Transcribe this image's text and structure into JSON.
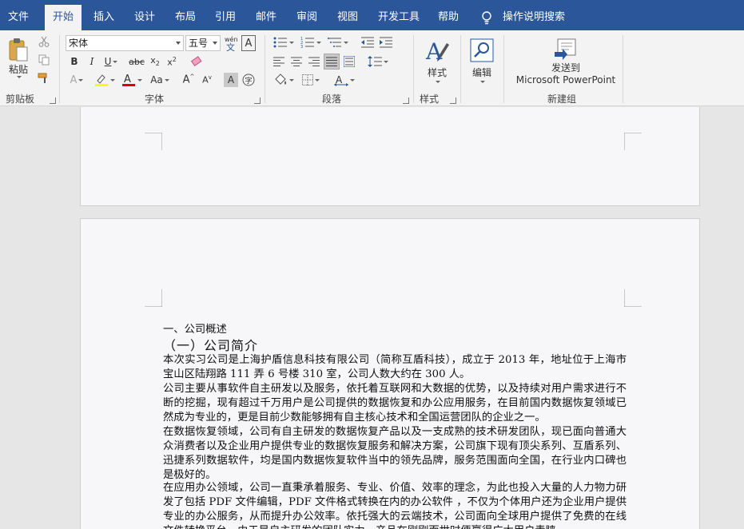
{
  "tabs": [
    {
      "label": "文件"
    },
    {
      "label": "开始"
    },
    {
      "label": "插入"
    },
    {
      "label": "设计"
    },
    {
      "label": "布局"
    },
    {
      "label": "引用"
    },
    {
      "label": "邮件"
    },
    {
      "label": "审阅"
    },
    {
      "label": "视图"
    },
    {
      "label": "开发工具"
    },
    {
      "label": "帮助"
    }
  ],
  "tell_me": "操作说明搜索",
  "ribbon": {
    "clipboard": {
      "paste_label": "粘贴",
      "group_label": "剪贴板"
    },
    "font": {
      "font_name": "宋体",
      "font_size": "五号",
      "group_label": "字体"
    },
    "paragraph": {
      "group_label": "段落"
    },
    "styles": {
      "label": "样式",
      "group_label": "样式"
    },
    "editing": {
      "label": "编辑"
    },
    "new_group": {
      "send_line1": "发送到",
      "send_line2": "Microsoft PowerPoint",
      "group_label": "新建组"
    }
  },
  "document": {
    "heading1": "一、公司概述",
    "heading2": "（一）公司简介",
    "paragraphs": [
      "本次实习公司是上海护盾信息科技有限公司（简称互盾科技），成立于 2013 年，地址位于上海市宝山区陆翔路 111 弄 6 号楼 310 室，公司人数大约在 300 人。",
      "公司主要从事软件自主研发以及服务，依托着互联网和大数据的优势，以及持续对用户需求进行不断的挖掘，现有超过千万用户是公司提供的数据恢复和办公应用服务，在目前国内数据恢复领域已然成为专业的，更是目前少数能够拥有自主核心技术和全国运营团队的企业之一。",
      "在数据恢复领域，公司有自主研发的数据恢复产品以及一支成熟的技术研发团队，现已面向普通大众消费者以及企业用户提供专业的数据恢复服务和解决方案，公司旗下现有顶尖系列、互盾系列、迅捷系列数据软件，均是国内数据恢复软件当中的领先品牌，服务范围面向全国，在行业内口碑也是极好的。",
      "在应用办公领域，公司一直秉承着服务、专业、价值、效率的理念，为此也投入大量的人力物力研发了包括 PDF 文件编辑，PDF 文件格式转换在内的办公软件 ，不仅为个体用户还为企业用户提供专业的办公服务，从而提升办公效率。依托强大的云端技术，公司面向全球用户提供了免费的在线文件转换平台，由于是自主研发的团队实力，产品在刚刚面世时便赢得广大用户青睐。"
    ]
  }
}
